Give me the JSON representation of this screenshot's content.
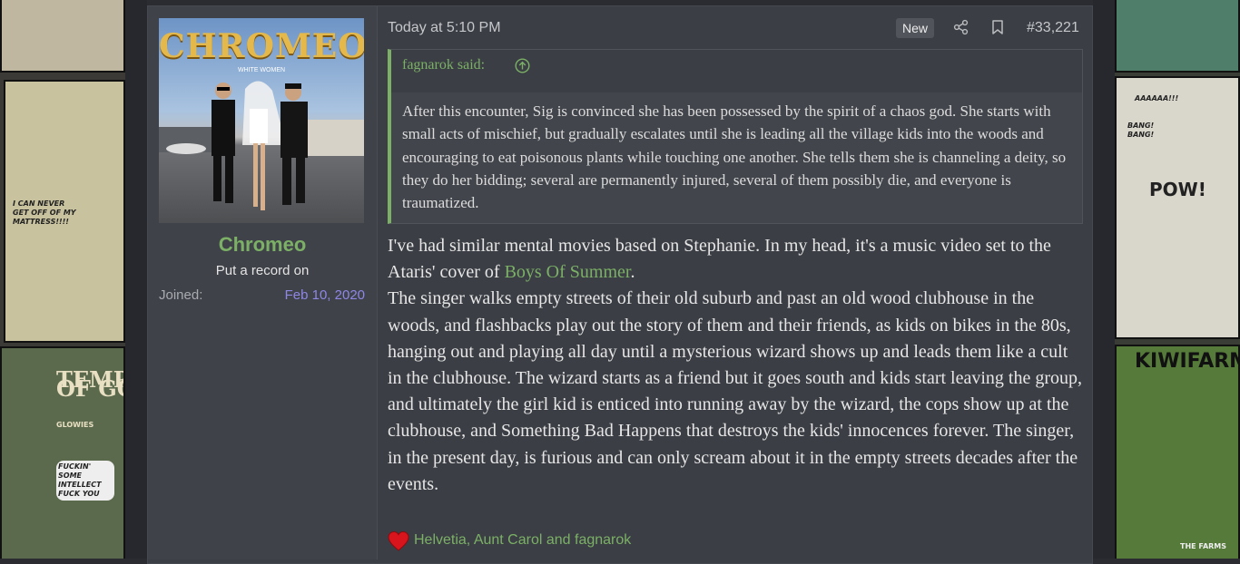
{
  "background": {
    "left_panels": [
      "I CAN NEVER GET OFF OF MY MATTRESS!!!!",
      "TEMPLE OF GO",
      "GLOWIES",
      "FUCKIN' SOME INTELLECT FUCK YOU"
    ],
    "right_panels": [
      "AAAAAA!!!",
      "POW!",
      "BANG! BANG!",
      "KIWIFARMS",
      "THE FARMS"
    ]
  },
  "user": {
    "avatar_logo": "CHROMEO",
    "avatar_subtitle": "WHITE WOMEN",
    "name": "Chromeo",
    "title": "Put a record on",
    "joined_label": "Joined:",
    "joined_date": "Feb 10, 2020"
  },
  "post": {
    "date": "Today at 5:10 PM",
    "new_badge": "New",
    "number": "#33,221",
    "quote": {
      "author_line": "fagnarok said:",
      "text": "After this encounter, Sig is convinced she has been possessed by the spirit of a chaos god. She starts with small acts of mischief, but gradually escalates until she is leading all the village kids into the woods and encouraging to eat poisonous plants while touching one another. She tells them she is channeling a deity, so they do her bidding; several are permanently injured, several of them possibly die, and everyone is traumatized."
    },
    "body": {
      "p1_before": "I've had similar mental movies based on Stephanie. In my head, it's a music video set to the Ataris' cover of ",
      "p1_link": "Boys Of Summer",
      "p1_after": ".",
      "p2": "The singer walks empty streets of their old suburb and past an old wood clubhouse in the woods, and flashbacks play out the story of them and their friends, as kids on bikes in the 80s, hanging out and playing all day until a mysterious wizard shows up and leads them like a cult in the clubhouse. The wizard starts as a friend but it goes south and kids start leaving the group, and ultimately the girl kid is enticed into running away by the wizard, the cops show up at the clubhouse, and Something Bad Happens that destroys the kids' innocences forever. The singer, in the present day, is furious and can only scream about it in the empty streets decades after the events."
    },
    "reactions": "Helvetia, Aunt Carol and fagnarok"
  },
  "colors": {
    "accent_green": "#7bb066",
    "joined_purple": "#8e87e6",
    "post_bg": "#3b3e44",
    "heart_red": "#d8141c"
  },
  "icons": [
    "share-icon",
    "bookmark-icon",
    "arrow-up-circle-icon",
    "heart-reaction-icon"
  ]
}
